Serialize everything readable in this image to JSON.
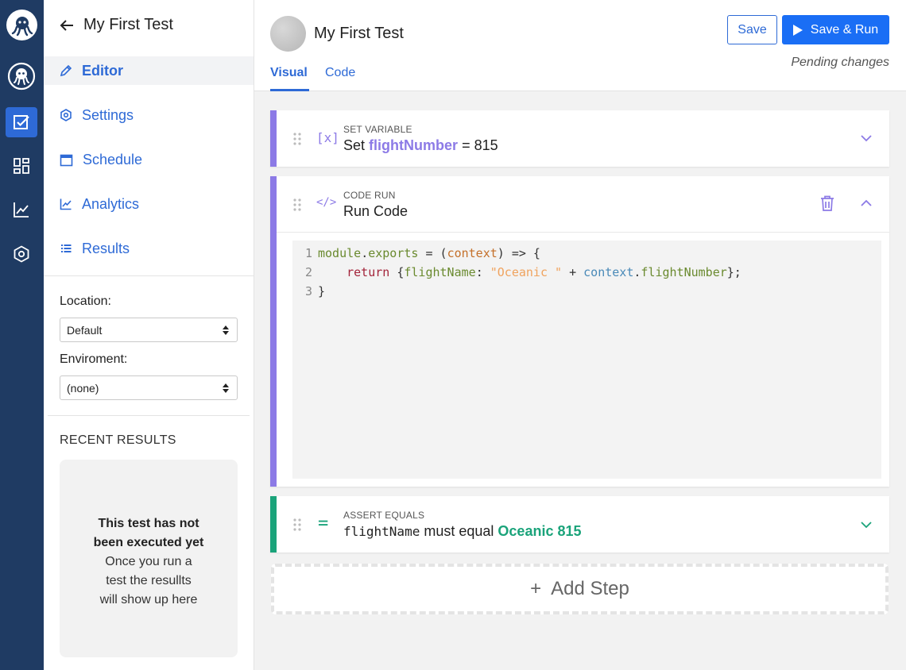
{
  "sidebar": {
    "back_title": "My First Test",
    "nav": [
      {
        "label": "Editor",
        "icon": "pencil-icon"
      },
      {
        "label": "Settings",
        "icon": "settings-icon"
      },
      {
        "label": "Schedule",
        "icon": "calendar-icon"
      },
      {
        "label": "Analytics",
        "icon": "chart-icon"
      },
      {
        "label": "Results",
        "icon": "list-icon"
      }
    ],
    "location_label": "Location:",
    "location_value": "Default",
    "environment_label": "Enviroment:",
    "environment_value": "(none)",
    "recent_title": "RECENT RESULTS",
    "recent_empty_line1": "This test has not",
    "recent_empty_line2": "been executed yet",
    "recent_empty_line3": "Once you run a",
    "recent_empty_line4": "test the resullts",
    "recent_empty_line5": "will show up here"
  },
  "header": {
    "title": "My First Test",
    "tabs": [
      {
        "label": "Visual"
      },
      {
        "label": "Code"
      }
    ],
    "save_label": "Save",
    "save_run_label": "Save & Run",
    "status": "Pending changes"
  },
  "steps": [
    {
      "type": "SET VARIABLE",
      "icon_text": "[x]",
      "prefix": "Set",
      "variable": "flightNumber",
      "operator": "=",
      "value": "815",
      "accent": "#8c7ae6"
    },
    {
      "type": "CODE RUN",
      "icon_text": "</>",
      "title": "Run Code",
      "accent": "#8c7ae6",
      "code": {
        "line_numbers": [
          "1",
          "2",
          "3"
        ],
        "line1": {
          "a": "module",
          "b": ".",
          "c": "exports",
          "d": " = (",
          "e": "context",
          "f": ") => {"
        },
        "line2": {
          "a": "    return",
          "b": " {",
          "c": "flightName",
          "d": ": ",
          "e": "\"Oceanic \"",
          "f": " + ",
          "g": "context",
          "h": ".",
          "i": "flightNumber",
          "j": "};"
        },
        "line3": "}"
      }
    },
    {
      "type": "ASSERT EQUALS",
      "icon_text": "=",
      "subject": "flightName",
      "middle": "must equal",
      "expected": "Oceanic 815",
      "accent": "#1aa37a"
    }
  ],
  "add_step": {
    "plus": "+",
    "label": "Add Step"
  }
}
